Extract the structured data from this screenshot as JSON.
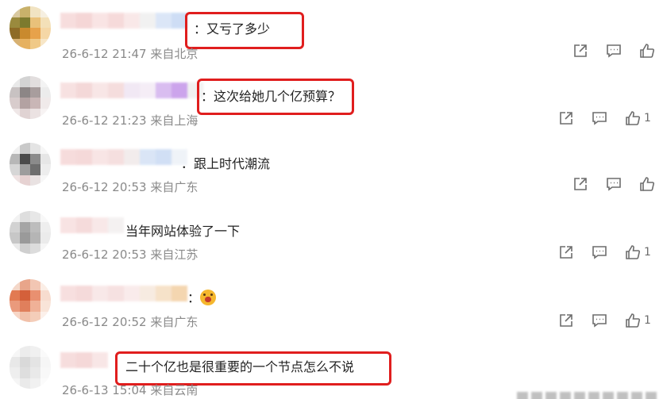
{
  "comments": [
    {
      "text": "：又亏了多少",
      "time": "26-6-12 21:47",
      "location": "来自北京",
      "likes": ""
    },
    {
      "text": "：这次给她几个亿预算？",
      "time": "26-6-12 21:23",
      "location": "来自上海",
      "likes": "1"
    },
    {
      "text": "．跟上时代潮流",
      "time": "26-6-12 20:53",
      "location": "来自广东",
      "likes": ""
    },
    {
      "text": "当年网站体验了一下",
      "time": "26-6-12 20:53",
      "location": "来自江苏",
      "likes": "1"
    },
    {
      "text": "：",
      "emoji": "surprised-emoji",
      "time": "26-6-12 20:52",
      "location": "来自广东",
      "likes": "1"
    },
    {
      "text": "二十个亿也是很重要的一个节点怎么不说",
      "time": "26-6-13 15:04",
      "location": "来自云南",
      "likes": ""
    }
  ],
  "icons": {
    "share": "share-icon",
    "comment": "comment-icon",
    "like": "thumbs-up-icon"
  },
  "colors": {
    "highlight": "#e01e1e",
    "meta_text": "#8a8a8a",
    "icon": "#6d6d6d"
  }
}
